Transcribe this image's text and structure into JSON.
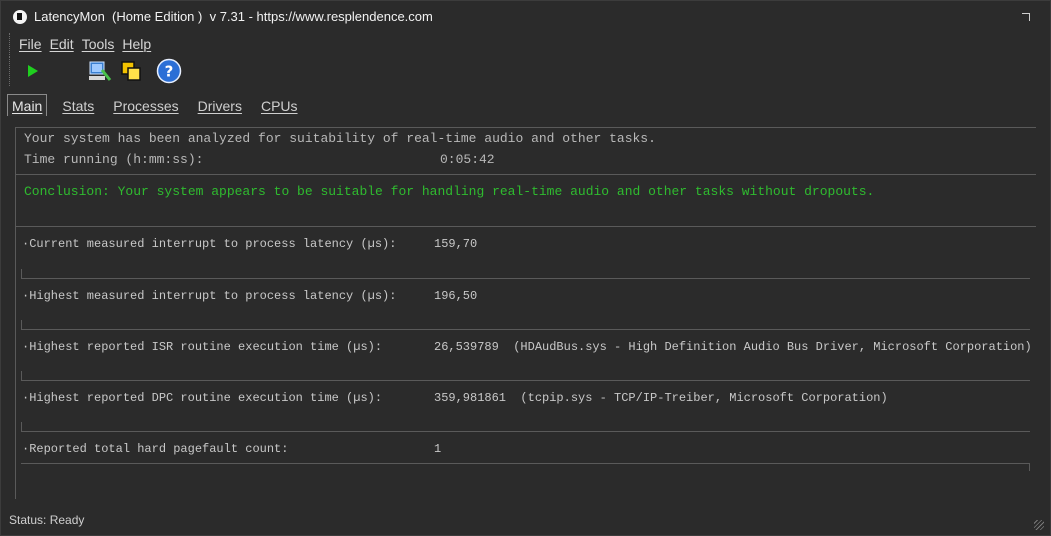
{
  "window": {
    "title": "LatencyMon  (Home Edition )  v 7.31 - https://www.resplendence.com"
  },
  "menu": {
    "file": "File",
    "edit": "Edit",
    "tools": "Tools",
    "help": "Help"
  },
  "toolbar": {
    "icons": [
      "play-icon",
      "analyze-tool-icon",
      "windows-icon",
      "help-icon"
    ]
  },
  "tabs": {
    "main": "Main",
    "stats": "Stats",
    "processes": "Processes",
    "drivers": "Drivers",
    "cpus": "CPUs",
    "active": "Main"
  },
  "main": {
    "analyzed": "Your system has been analyzed for suitability of real-time audio and other tasks.",
    "time_label": "Time running (h:mm:ss):",
    "time_value": "0:05:42",
    "conclusion": "Conclusion: Your system appears to be suitable for handling real-time audio and other tasks without dropouts.",
    "metrics": [
      {
        "label": "·Current measured interrupt to process latency (µs):",
        "value": "159,70"
      },
      {
        "label": "·Highest measured interrupt to process latency (µs):",
        "value": "196,50"
      },
      {
        "label": "·Highest reported ISR routine execution time (µs):",
        "value": "26,539789  (HDAudBus.sys - High Definition Audio Bus Driver, Microsoft Corporation)"
      },
      {
        "label": "·Highest reported DPC routine execution time (µs):",
        "value": "359,981861  (tcpip.sys - TCP/IP-Treiber, Microsoft Corporation)"
      },
      {
        "label": "·Reported total hard pagefault count:",
        "value": "1"
      }
    ]
  },
  "status": {
    "text": "Status: Ready"
  },
  "colors": {
    "background": "#2b2b2b",
    "conclusion": "#2fbb2f",
    "text": "#c8c8c8"
  }
}
